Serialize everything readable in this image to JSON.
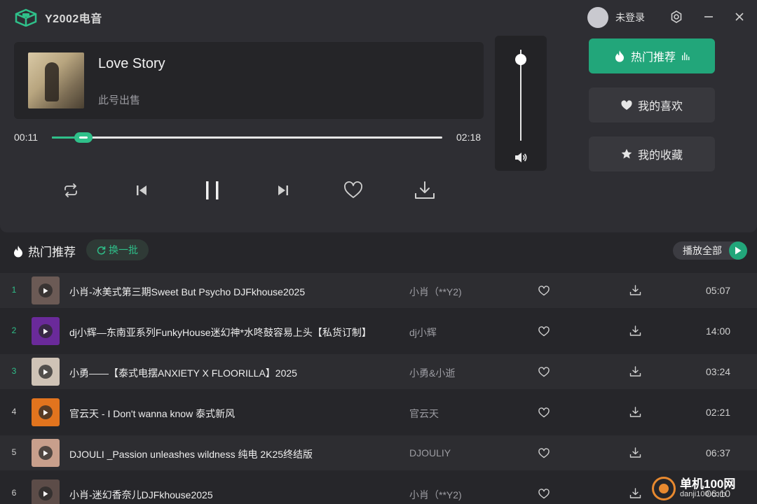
{
  "app": {
    "title": "Y2002电音"
  },
  "user": {
    "name": "未登录"
  },
  "window": {
    "settings_icon": "gear-icon",
    "minimize_icon": "minimize-icon",
    "close_icon": "close-icon"
  },
  "now_playing": {
    "title": "Love Story",
    "artist": "此号出售",
    "current_time": "00:11",
    "total_time": "02:18",
    "progress_fraction": 0.08,
    "volume_fraction": 0.89
  },
  "side_nav": [
    {
      "label": "热门推荐",
      "icon": "flame-icon",
      "active": true
    },
    {
      "label": "我的喜欢",
      "icon": "heart-icon",
      "active": false
    },
    {
      "label": "我的收藏",
      "icon": "star-icon",
      "active": false
    }
  ],
  "list": {
    "title": "热门推荐",
    "refresh_label": "换一批",
    "play_all_label": "播放全部",
    "tracks": [
      {
        "index": "1",
        "name": "小肖-冰美式第三期Sweet But Psycho DJFkhouse2025",
        "artist": "小肖（**Y2)",
        "duration": "05:07",
        "thumb": "#6b5a55"
      },
      {
        "index": "2",
        "name": "dj小辉—东南亚系列FunkyHouse迷幻神*水咚鼓容易上头【私货订制】",
        "artist": "dj小辉",
        "duration": "14:00",
        "thumb": "#6a2a9a"
      },
      {
        "index": "3",
        "name": "小勇——【泰式电摆ANXIETY X FLOORILLA】2025",
        "artist": "小勇&小逝",
        "duration": "03:24",
        "thumb": "#cfc3b6"
      },
      {
        "index": "4",
        "name": "官云天 - I Don't wanna know 泰式新风",
        "artist": "官云天",
        "duration": "02:21",
        "thumb": "#e2741e"
      },
      {
        "index": "5",
        "name": "DJOULI _Passion unleashes wildness 纯电 2K25终结版",
        "artist": "DJOULIY",
        "duration": "06:37",
        "thumb": "#c89f8c"
      },
      {
        "index": "6",
        "name": "小肖-迷幻香奈儿DJFkhouse2025",
        "artist": "小肖（**Y2)",
        "duration": "06:10",
        "thumb": "#5c4c48"
      }
    ]
  },
  "watermark": {
    "main": "单机100网",
    "sub": "danji100.com"
  },
  "colors": {
    "accent": "#22a67a",
    "accent_text": "#2fc08a",
    "background": "#26262a",
    "panel": "#2e2e33"
  }
}
